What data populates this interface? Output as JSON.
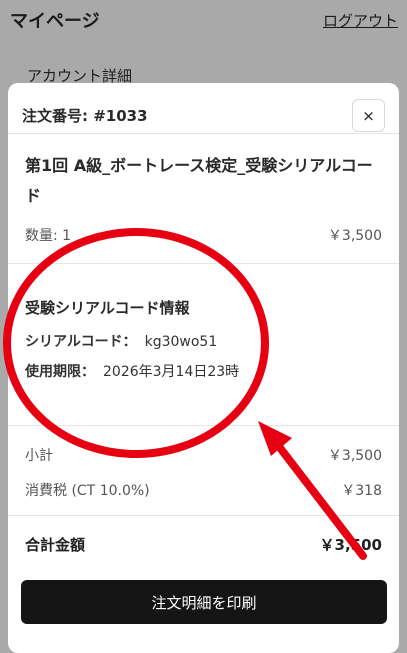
{
  "page": {
    "title": "マイページ",
    "logout_label": "ログアウト",
    "account_label": "アカウント詳細"
  },
  "modal": {
    "order_number": "注文番号: #1033",
    "close_label": "×",
    "product_name": "第1回 A級_ボートレース検定_受験シリアルコード",
    "quantity": "数量: 1",
    "line_price": "￥3,500",
    "serial_section_title": "受験シリアルコード情報",
    "serial_code_label": "シリアルコード：",
    "serial_code_value": "kg30wo51",
    "expiry_label": "使用期限：",
    "expiry_value": "2026年3月14日23時",
    "subtotal_label": "小計",
    "subtotal_value": "￥3,500",
    "tax_label": "消費税 (CT 10.0%)",
    "tax_value": "￥318",
    "total_label": "合計金額",
    "total_value": "￥3,500",
    "print_button_label": "注文明細を印刷"
  },
  "annotation": {
    "color": "#e60012",
    "shapes": [
      "red-circle",
      "red-arrow"
    ]
  }
}
